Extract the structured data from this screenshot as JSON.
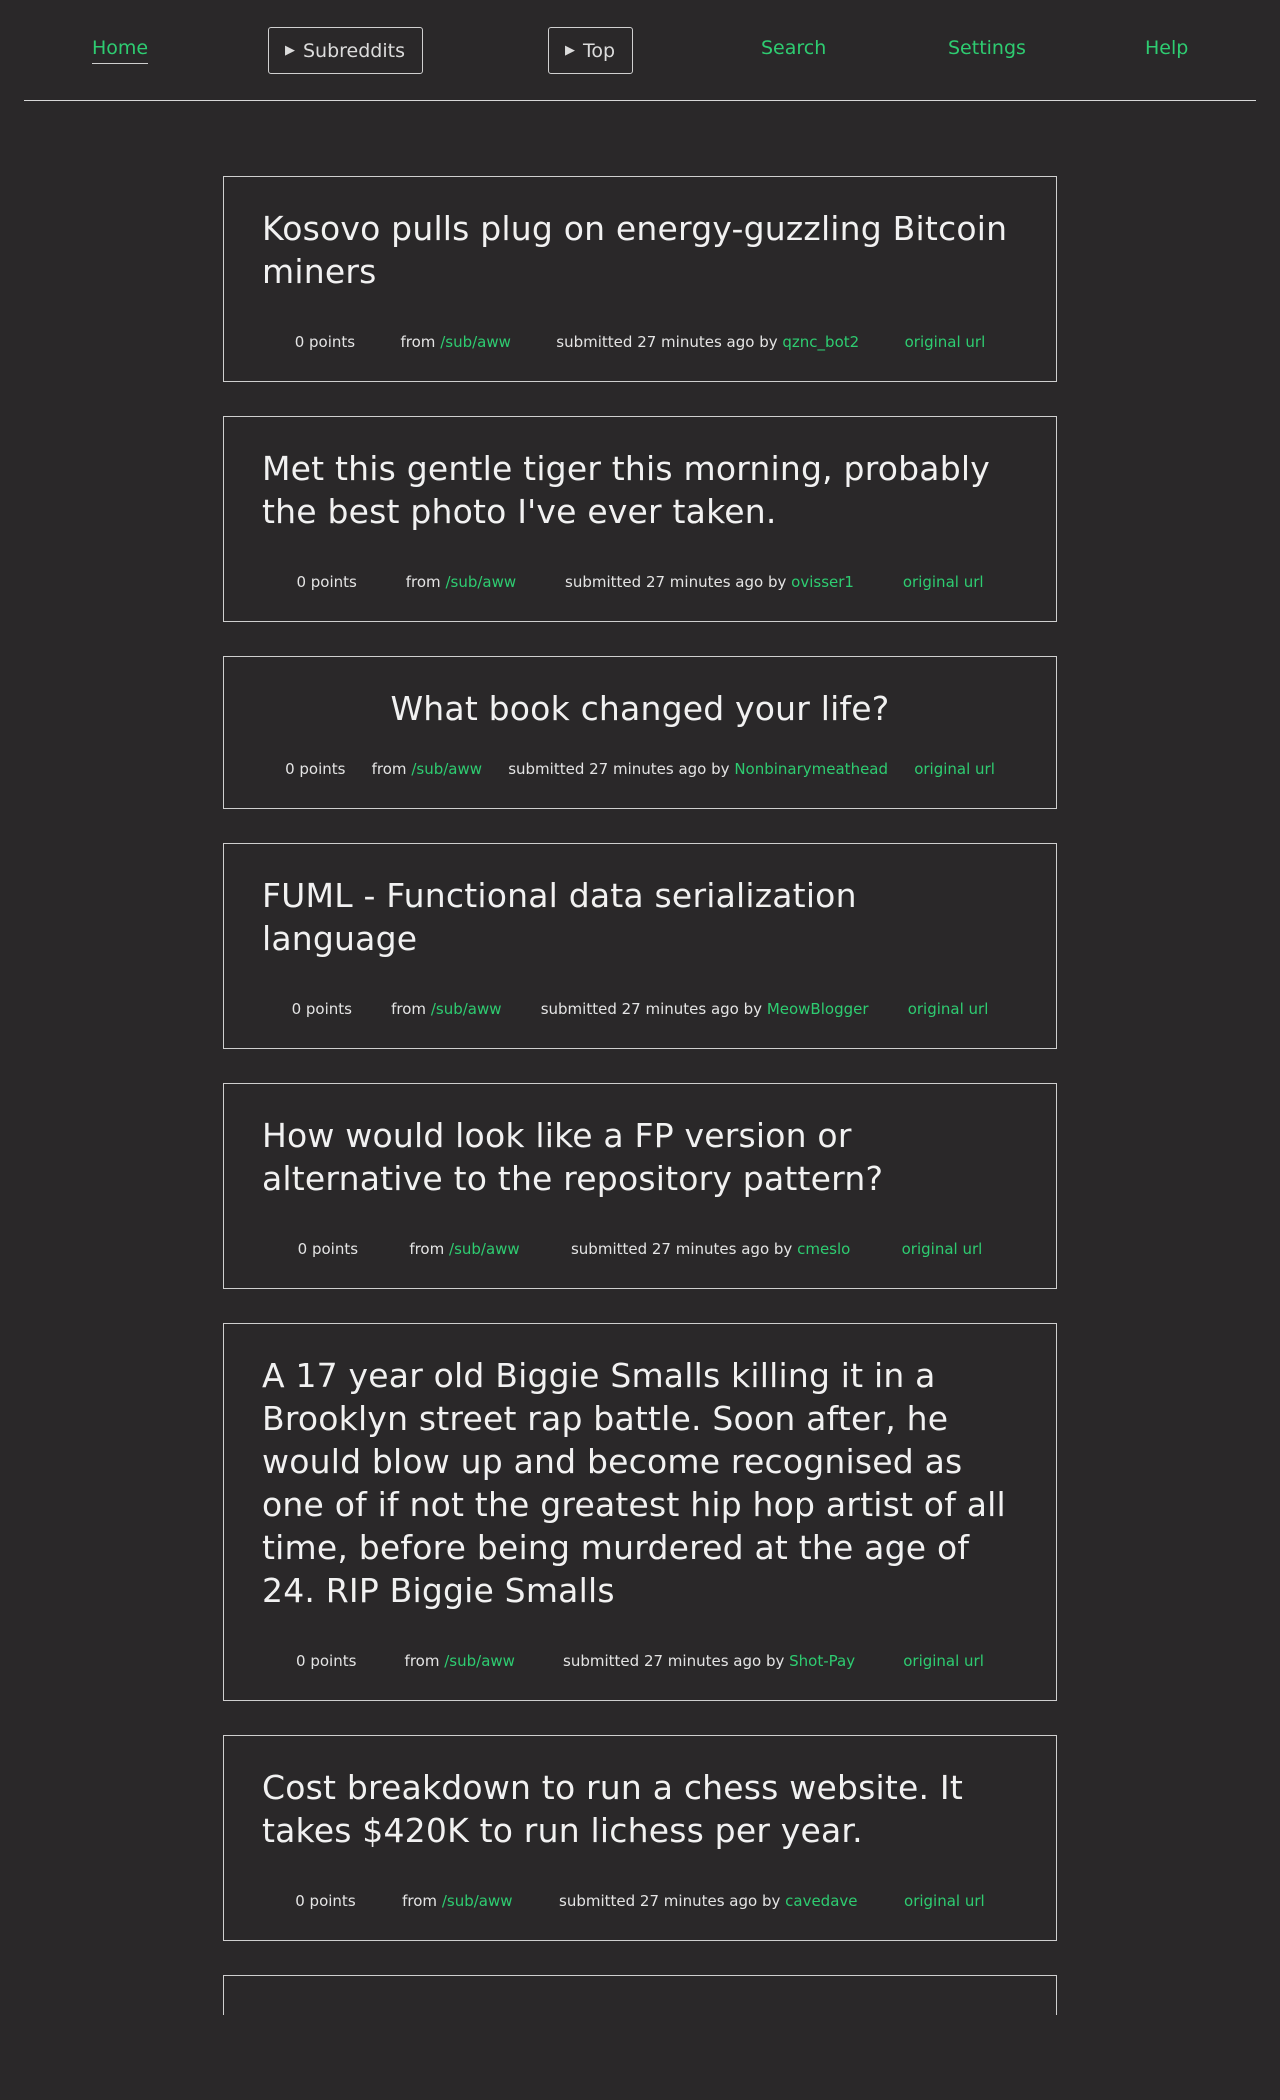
{
  "nav": {
    "home": "Home",
    "subreddits": "Subreddits",
    "top": "Top",
    "search": "Search",
    "settings": "Settings",
    "help": "Help"
  },
  "colors": {
    "background": "#2a2829",
    "accent": "#2ecc71",
    "text": "#f1f1f1"
  },
  "icons": {
    "dropdown": "triangle-right-icon"
  },
  "posts": [
    {
      "title": "Kosovo pulls plug on energy-guzzling Bitcoin miners",
      "points": "0 points",
      "from_label": "from",
      "subreddit": "/sub/aww",
      "submitted": "submitted 27 minutes ago",
      "by_label": "by",
      "author": "qznc_bot2",
      "url_label": "original url"
    },
    {
      "title": "Met this gentle tiger this morning, probably the best photo I've ever taken.",
      "points": "0 points",
      "from_label": "from",
      "subreddit": "/sub/aww",
      "submitted": "submitted 27 minutes ago",
      "by_label": "by",
      "author": "ovisser1",
      "url_label": "original url"
    },
    {
      "title": "What book changed your life?",
      "points": "0 points",
      "from_label": "from",
      "subreddit": "/sub/aww",
      "submitted": "submitted 27 minutes ago",
      "by_label": "by",
      "author": "Nonbinarymeathead",
      "url_label": "original url"
    },
    {
      "title": "FUML - Functional data serialization language",
      "points": "0 points",
      "from_label": "from",
      "subreddit": "/sub/aww",
      "submitted": "submitted 27 minutes ago",
      "by_label": "by",
      "author": "MeowBlogger",
      "url_label": "original url"
    },
    {
      "title": "How would look like a FP version or alternative to the repository pattern?",
      "points": "0 points",
      "from_label": "from",
      "subreddit": "/sub/aww",
      "submitted": "submitted 27 minutes ago",
      "by_label": "by",
      "author": "cmeslo",
      "url_label": "original url"
    },
    {
      "title": "A 17 year old Biggie Smalls killing it in a Brooklyn street rap battle. Soon after, he would blow up and become recognised as one of if not the greatest hip hop artist of all time, before being murdered at the age of 24. RIP Biggie Smalls",
      "points": "0 points",
      "from_label": "from",
      "subreddit": "/sub/aww",
      "submitted": "submitted 27 minutes ago",
      "by_label": "by",
      "author": "Shot-Pay",
      "url_label": "original url"
    },
    {
      "title": "Cost breakdown to run a chess website. It takes $420K to run lichess per year.",
      "points": "0 points",
      "from_label": "from",
      "subreddit": "/sub/aww",
      "submitted": "submitted 27 minutes ago",
      "by_label": "by",
      "author": "cavedave",
      "url_label": "original url"
    }
  ]
}
